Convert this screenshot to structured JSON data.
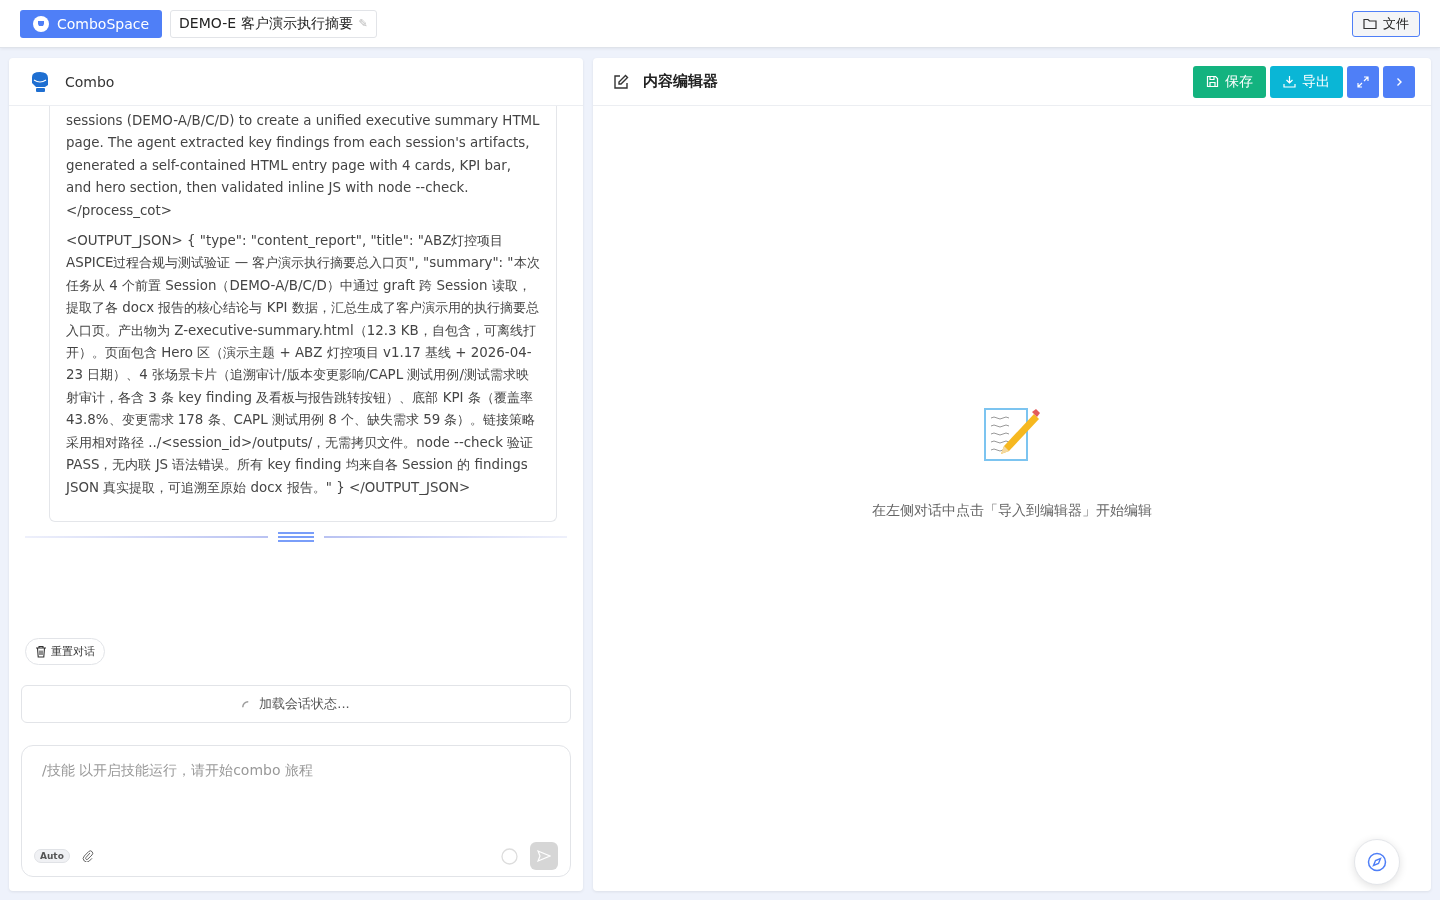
{
  "topbar": {
    "brand": "ComboSpace",
    "session_title": "DEMO-E 客户演示执行摘要",
    "edit_mark": "✎",
    "files_button": "文件"
  },
  "chat": {
    "agent_name": "Combo",
    "message_paragraphs": [
      "sessions (DEMO-A/B/C/D) to create a unified executive summary HTML page. The agent extracted key findings from each session's artifacts, generated a self-contained HTML entry page with 4 cards, KPI bar, and hero section, then validated inline JS with node --check. </process_cot>",
      "<OUTPUT_JSON> { \"type\": \"content_report\", \"title\": \"ABZ灯控项目ASPICE过程合规与测试验证 — 客户演示执行摘要总入口页\", \"summary\": \"本次任务从 4 个前置 Session（DEMO-A/B/C/D）中通过 graft 跨 Session 读取，提取了各 docx 报告的核心结论与 KPI 数据，汇总生成了客户演示用的执行摘要总入口页。产出物为 Z-executive-summary.html（12.3 KB，自包含，可离线打开）。页面包含 Hero 区（演示主题 + ABZ 灯控项目 v1.17 基线 + 2026-04-23 日期）、4 张场景卡片（追溯审计/版本变更影响/CAPL 测试用例/测试需求映射审计，各含 3 条 key finding 及看板与报告跳转按钮）、底部 KPI 条（覆盖率 43.8%、变更需求 178 条、CAPL 测试用例 8 个、缺失需求 59 条）。链接策略采用相对路径 ../<session_id>/outputs/，无需拷贝文件。node --check 验证 PASS，无内联 JS 语法错误。所有 key finding 均来自各 Session 的 findings JSON 真实提取，可追溯至原始 docx 报告。\" } </OUTPUT_JSON>"
    ],
    "reset_button": "重置对话",
    "loading_text": "加载会话状态...",
    "input": {
      "placeholder": "/技能 以开启技能运行，请开始combo 旅程"
    },
    "mode_badge": "Auto",
    "send_disabled": true
  },
  "editor": {
    "title": "内容编辑器",
    "save_button": "保存",
    "export_button": "导出",
    "empty_hint": "在左侧对话中点击「导入到编辑器」开始编辑"
  }
}
